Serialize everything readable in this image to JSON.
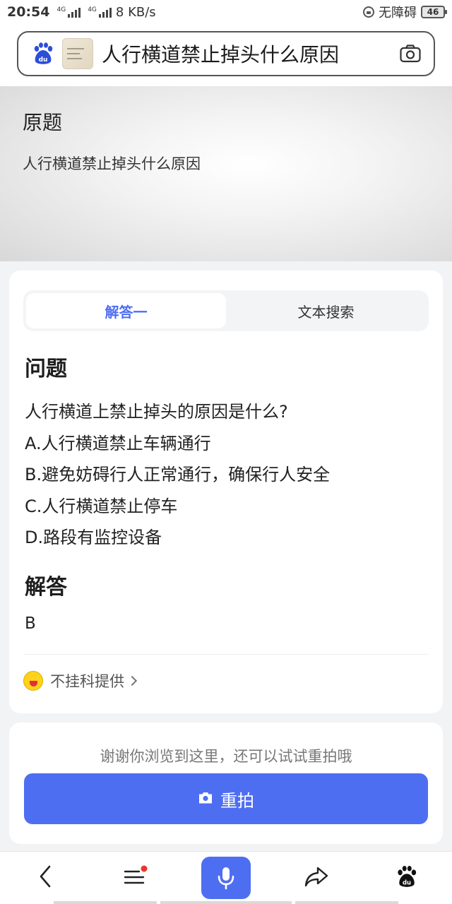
{
  "status_bar": {
    "time": "20:54",
    "net1": "4G",
    "net2": "4G",
    "speed": "8 KB/s",
    "accessibility": "无障碍",
    "battery": "46"
  },
  "search": {
    "query": "人行横道禁止掉头什么原因"
  },
  "original": {
    "title": "原题",
    "text": "人行横道禁止掉头什么原因"
  },
  "tabs": [
    {
      "label": "解答一",
      "active": true
    },
    {
      "label": "文本搜索",
      "active": false
    }
  ],
  "question": {
    "heading": "问题",
    "lines": [
      "人行横道上禁止掉头的原因是什么?",
      "A.人行横道禁止车辆通行",
      "B.避免妨碍行人正常通行，确保行人安全",
      "C.人行横道禁止停车",
      "D.路段有监控设备"
    ]
  },
  "answer": {
    "heading": "解答",
    "value": "B"
  },
  "provider": {
    "label": "不挂科提供"
  },
  "retake": {
    "hint": "谢谢你浏览到这里，还可以试试重拍哦",
    "button_label": "重拍"
  },
  "colors": {
    "accent": "#4e6ef2",
    "notification_dot": "#e8362f"
  },
  "bottom_nav": [
    "back-icon",
    "menu-icon",
    "mic-icon",
    "share-icon",
    "baidu-paw-icon"
  ]
}
